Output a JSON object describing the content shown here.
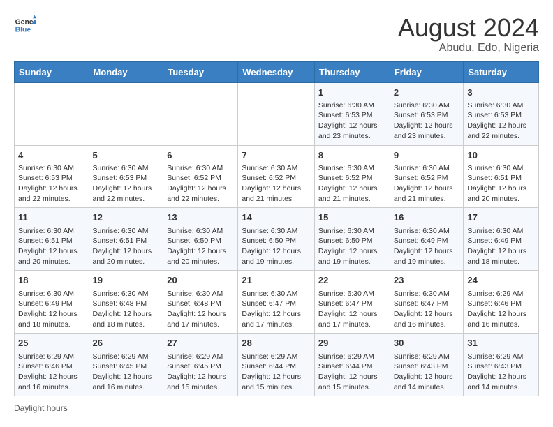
{
  "header": {
    "logo_general": "General",
    "logo_blue": "Blue",
    "month_year": "August 2024",
    "location": "Abudu, Edo, Nigeria"
  },
  "days_of_week": [
    "Sunday",
    "Monday",
    "Tuesday",
    "Wednesday",
    "Thursday",
    "Friday",
    "Saturday"
  ],
  "weeks": [
    [
      {
        "day": "",
        "info": ""
      },
      {
        "day": "",
        "info": ""
      },
      {
        "day": "",
        "info": ""
      },
      {
        "day": "",
        "info": ""
      },
      {
        "day": "1",
        "info": "Sunrise: 6:30 AM\nSunset: 6:53 PM\nDaylight: 12 hours and 23 minutes."
      },
      {
        "day": "2",
        "info": "Sunrise: 6:30 AM\nSunset: 6:53 PM\nDaylight: 12 hours and 23 minutes."
      },
      {
        "day": "3",
        "info": "Sunrise: 6:30 AM\nSunset: 6:53 PM\nDaylight: 12 hours and 22 minutes."
      }
    ],
    [
      {
        "day": "4",
        "info": "Sunrise: 6:30 AM\nSunset: 6:53 PM\nDaylight: 12 hours and 22 minutes."
      },
      {
        "day": "5",
        "info": "Sunrise: 6:30 AM\nSunset: 6:53 PM\nDaylight: 12 hours and 22 minutes."
      },
      {
        "day": "6",
        "info": "Sunrise: 6:30 AM\nSunset: 6:52 PM\nDaylight: 12 hours and 22 minutes."
      },
      {
        "day": "7",
        "info": "Sunrise: 6:30 AM\nSunset: 6:52 PM\nDaylight: 12 hours and 21 minutes."
      },
      {
        "day": "8",
        "info": "Sunrise: 6:30 AM\nSunset: 6:52 PM\nDaylight: 12 hours and 21 minutes."
      },
      {
        "day": "9",
        "info": "Sunrise: 6:30 AM\nSunset: 6:52 PM\nDaylight: 12 hours and 21 minutes."
      },
      {
        "day": "10",
        "info": "Sunrise: 6:30 AM\nSunset: 6:51 PM\nDaylight: 12 hours and 20 minutes."
      }
    ],
    [
      {
        "day": "11",
        "info": "Sunrise: 6:30 AM\nSunset: 6:51 PM\nDaylight: 12 hours and 20 minutes."
      },
      {
        "day": "12",
        "info": "Sunrise: 6:30 AM\nSunset: 6:51 PM\nDaylight: 12 hours and 20 minutes."
      },
      {
        "day": "13",
        "info": "Sunrise: 6:30 AM\nSunset: 6:50 PM\nDaylight: 12 hours and 20 minutes."
      },
      {
        "day": "14",
        "info": "Sunrise: 6:30 AM\nSunset: 6:50 PM\nDaylight: 12 hours and 19 minutes."
      },
      {
        "day": "15",
        "info": "Sunrise: 6:30 AM\nSunset: 6:50 PM\nDaylight: 12 hours and 19 minutes."
      },
      {
        "day": "16",
        "info": "Sunrise: 6:30 AM\nSunset: 6:49 PM\nDaylight: 12 hours and 19 minutes."
      },
      {
        "day": "17",
        "info": "Sunrise: 6:30 AM\nSunset: 6:49 PM\nDaylight: 12 hours and 18 minutes."
      }
    ],
    [
      {
        "day": "18",
        "info": "Sunrise: 6:30 AM\nSunset: 6:49 PM\nDaylight: 12 hours and 18 minutes."
      },
      {
        "day": "19",
        "info": "Sunrise: 6:30 AM\nSunset: 6:48 PM\nDaylight: 12 hours and 18 minutes."
      },
      {
        "day": "20",
        "info": "Sunrise: 6:30 AM\nSunset: 6:48 PM\nDaylight: 12 hours and 17 minutes."
      },
      {
        "day": "21",
        "info": "Sunrise: 6:30 AM\nSunset: 6:47 PM\nDaylight: 12 hours and 17 minutes."
      },
      {
        "day": "22",
        "info": "Sunrise: 6:30 AM\nSunset: 6:47 PM\nDaylight: 12 hours and 17 minutes."
      },
      {
        "day": "23",
        "info": "Sunrise: 6:30 AM\nSunset: 6:47 PM\nDaylight: 12 hours and 16 minutes."
      },
      {
        "day": "24",
        "info": "Sunrise: 6:29 AM\nSunset: 6:46 PM\nDaylight: 12 hours and 16 minutes."
      }
    ],
    [
      {
        "day": "25",
        "info": "Sunrise: 6:29 AM\nSunset: 6:46 PM\nDaylight: 12 hours and 16 minutes."
      },
      {
        "day": "26",
        "info": "Sunrise: 6:29 AM\nSunset: 6:45 PM\nDaylight: 12 hours and 16 minutes."
      },
      {
        "day": "27",
        "info": "Sunrise: 6:29 AM\nSunset: 6:45 PM\nDaylight: 12 hours and 15 minutes."
      },
      {
        "day": "28",
        "info": "Sunrise: 6:29 AM\nSunset: 6:44 PM\nDaylight: 12 hours and 15 minutes."
      },
      {
        "day": "29",
        "info": "Sunrise: 6:29 AM\nSunset: 6:44 PM\nDaylight: 12 hours and 15 minutes."
      },
      {
        "day": "30",
        "info": "Sunrise: 6:29 AM\nSunset: 6:43 PM\nDaylight: 12 hours and 14 minutes."
      },
      {
        "day": "31",
        "info": "Sunrise: 6:29 AM\nSunset: 6:43 PM\nDaylight: 12 hours and 14 minutes."
      }
    ]
  ],
  "footer": {
    "daylight_label": "Daylight hours"
  }
}
